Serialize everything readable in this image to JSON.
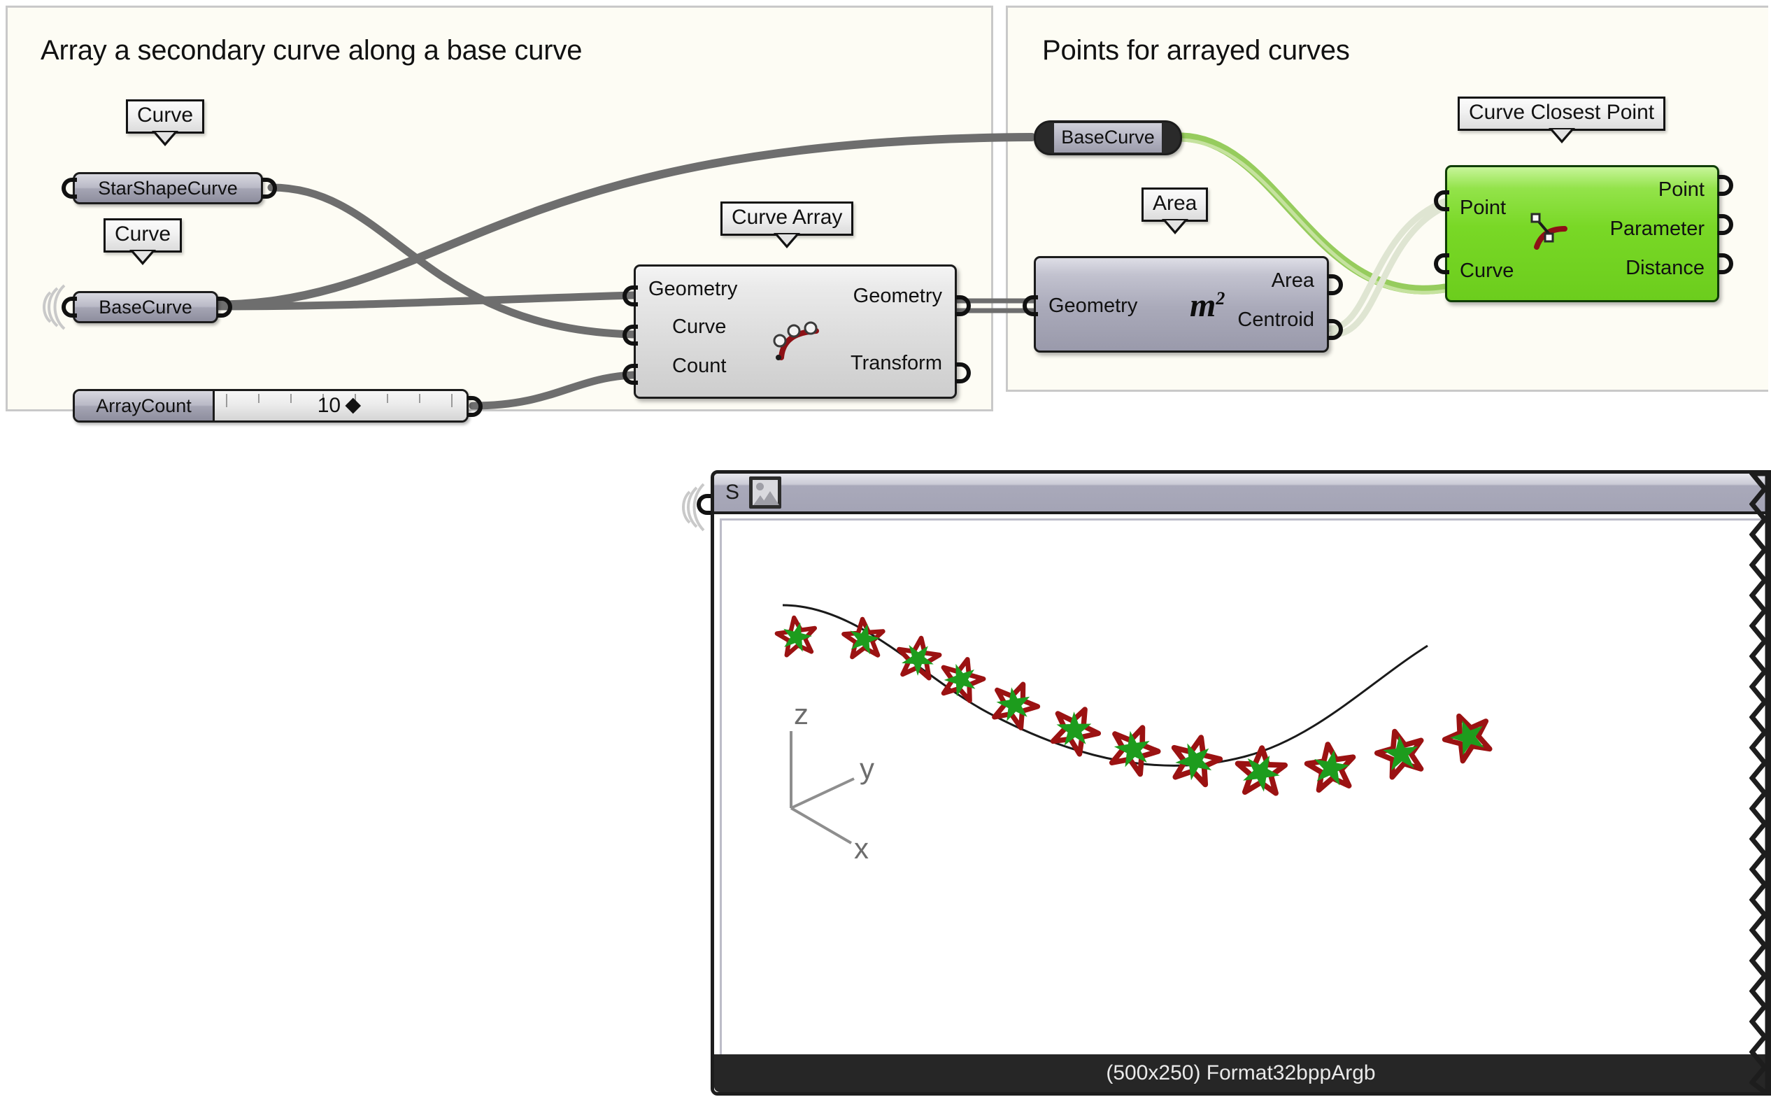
{
  "groups": [
    {
      "title": "Array a secondary curve along a base curve"
    },
    {
      "title": "Points for arrayed curves"
    }
  ],
  "params": [
    {
      "name": "StarShapeCurve",
      "tag": "Curve"
    },
    {
      "name": "BaseCurve",
      "tag": "Curve"
    },
    {
      "name": "BaseCurve"
    }
  ],
  "slider": {
    "name": "ArrayCount",
    "value": "10"
  },
  "components": [
    {
      "tag": "Curve Array",
      "icon": "curve-array-icon",
      "inputs": [
        "Geometry",
        "Curve",
        "Count"
      ],
      "outputs": [
        "Geometry",
        "Transform"
      ]
    },
    {
      "tag": "Area",
      "icon": "m-squared-icon",
      "glyph": "m",
      "superscript": "2",
      "inputs": [
        "Geometry"
      ],
      "outputs": [
        "Area",
        "Centroid"
      ]
    },
    {
      "tag": "Curve Closest Point",
      "icon": "curve-closest-point-icon",
      "inputs": [
        "Point",
        "Curve"
      ],
      "outputs": [
        "Point",
        "Parameter",
        "Distance"
      ]
    }
  ],
  "viewport": {
    "header_label": "S",
    "header_icon": "image-icon",
    "footer_status": "(500x250) Format32bppArgb",
    "axes": {
      "z": "z",
      "y": "y",
      "x": "x"
    },
    "star_count": 12
  },
  "colors": {
    "canvas": "#fdfcf4",
    "group_border": "#c9c9c9",
    "component_grey": "#dcdcdc",
    "component_dark": "#a9a9b9",
    "component_green": "#79d826",
    "wire_grey": "#6e6e6e",
    "wire_green": "#96cc5d",
    "wire_pale": "#dfe5d2",
    "star_fill": "#1d9c1d",
    "star_outline": "#9b1212",
    "curve_line": "#1a1a1a",
    "footer_bg": "#262626"
  }
}
